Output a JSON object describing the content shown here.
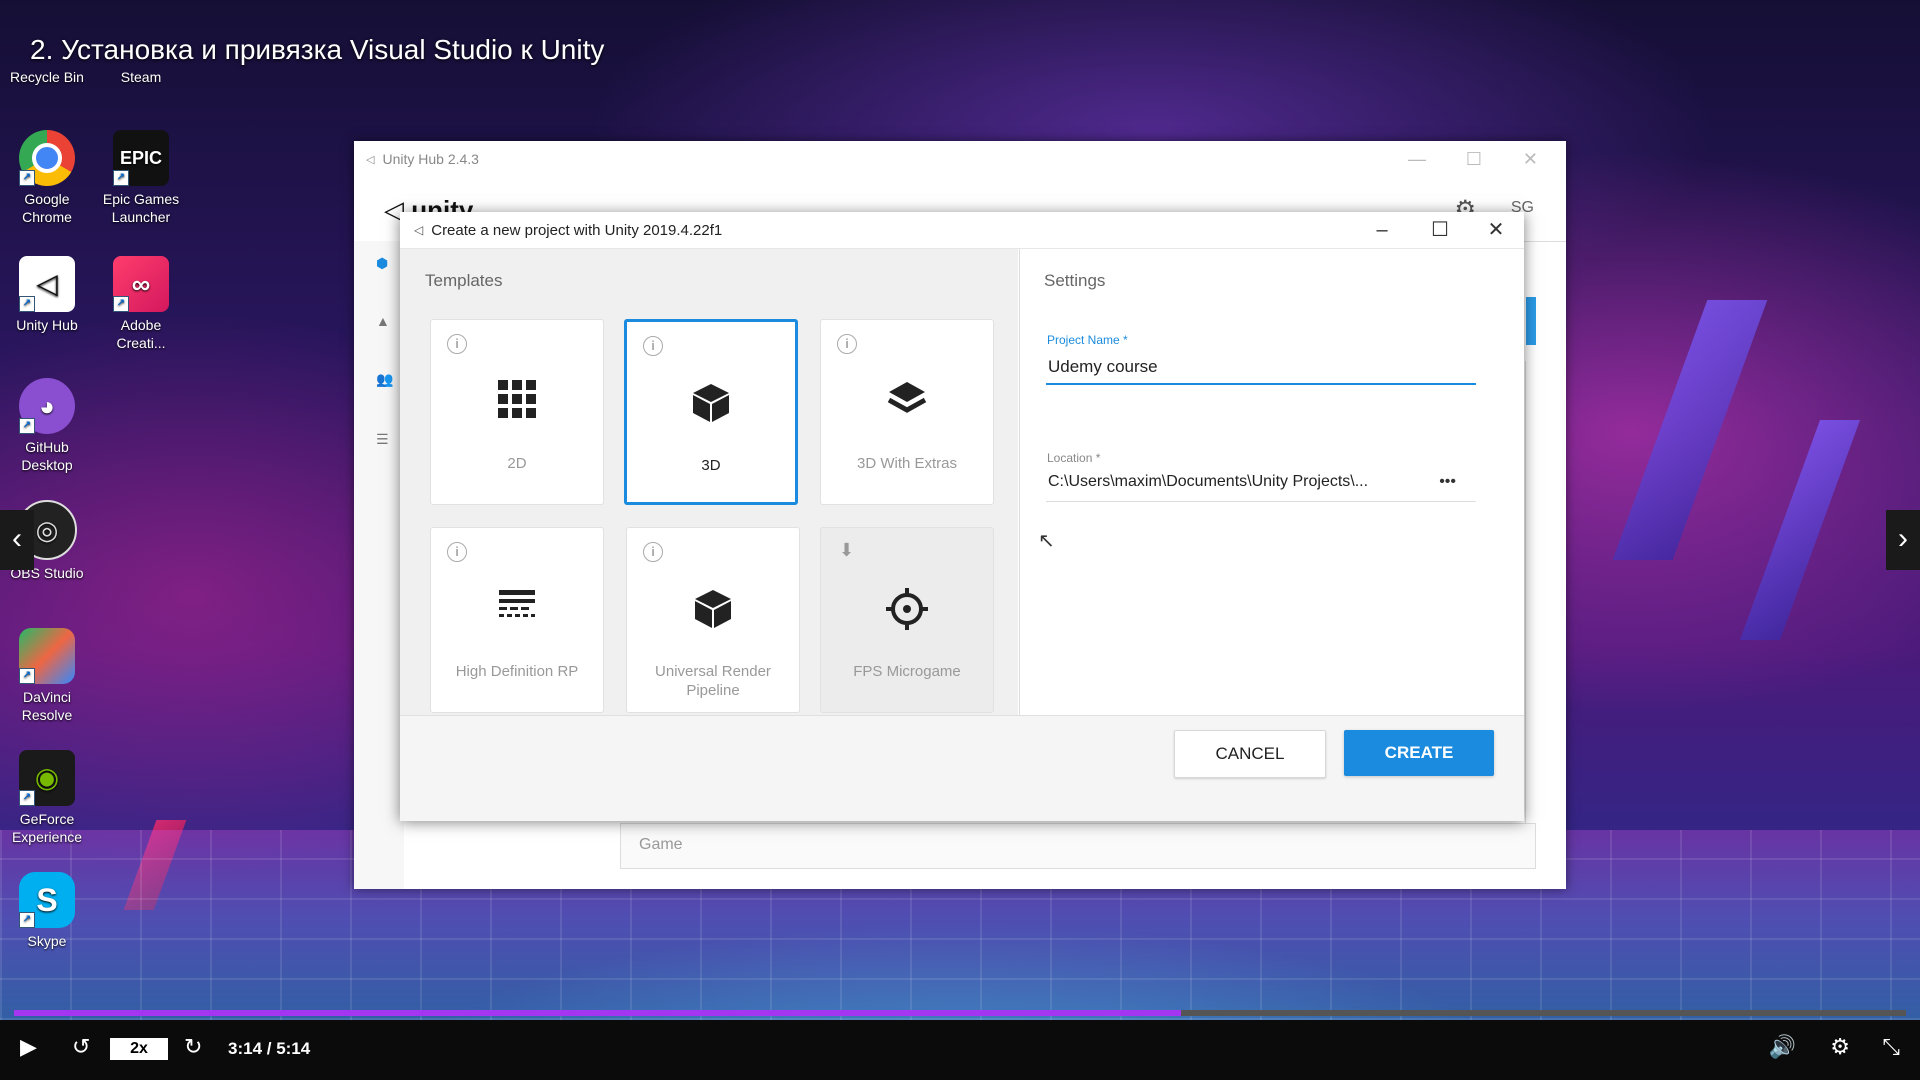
{
  "video": {
    "title": "2. Установка и привязка Visual Studio к Unity"
  },
  "desktop": {
    "icons": [
      {
        "label": "Recycle Bin"
      },
      {
        "label": "Steam"
      },
      {
        "label": "Google Chrome"
      },
      {
        "label": "Epic Games Launcher"
      },
      {
        "label": "Unity Hub"
      },
      {
        "label": "Adobe Creati..."
      },
      {
        "label": "GitHub Desktop"
      },
      {
        "label": "OBS Studio"
      },
      {
        "label": "DaVinci Resolve"
      },
      {
        "label": "GeForce Experience"
      },
      {
        "label": "Skype"
      }
    ]
  },
  "hub": {
    "title": "Unity Hub 2.4.3",
    "logo": "unity",
    "user_initials": "SG",
    "list_item": "Game"
  },
  "dialog": {
    "title": "Create a new project with Unity 2019.4.22f1",
    "templates_heading": "Templates",
    "settings_heading": "Settings",
    "templates": [
      {
        "label": "2D",
        "selected": false
      },
      {
        "label": "3D",
        "selected": true
      },
      {
        "label": "3D With Extras",
        "selected": false
      },
      {
        "label": "High Definition RP",
        "selected": false
      },
      {
        "label": "Universal Render Pipeline",
        "selected": false
      },
      {
        "label": "FPS Microgame",
        "selected": false
      }
    ],
    "project_name_label": "Project Name",
    "project_name_value": "Udemy course",
    "location_label": "Location",
    "location_value": "C:\\Users\\maxim\\Documents\\Unity Projects\\...",
    "location_more": "•••",
    "cancel_label": "CANCEL",
    "create_label": "CREATE"
  },
  "player": {
    "speed": "2x",
    "time": "3:14 / 5:14",
    "progress": 0.617,
    "accent": "#a435f0"
  }
}
